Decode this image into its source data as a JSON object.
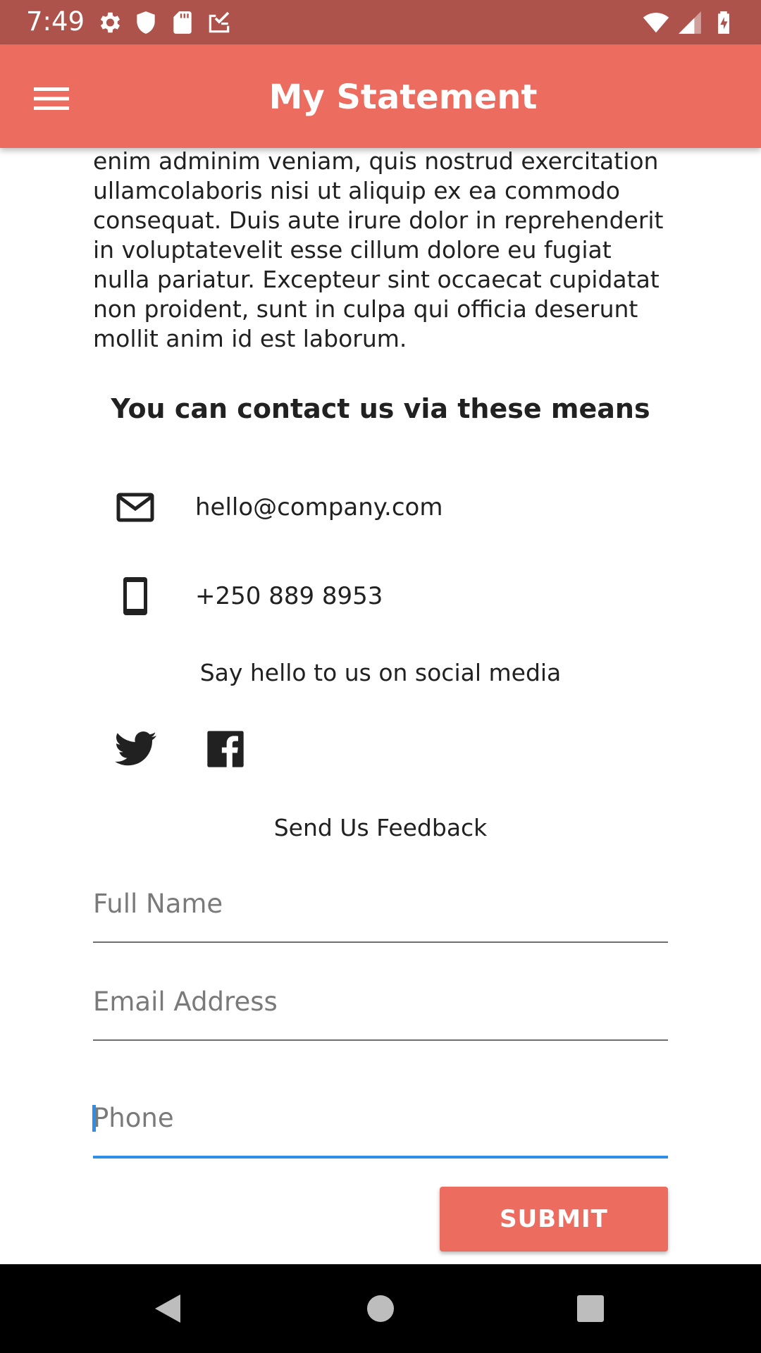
{
  "status_bar": {
    "time": "7:49",
    "left_icons": [
      "settings-icon",
      "shield-icon",
      "sd-card-icon",
      "check-list-icon"
    ],
    "right_icons": [
      "wifi-icon",
      "signal-icon",
      "battery-charging-icon"
    ],
    "background_color": "#ae534b"
  },
  "app_bar": {
    "title": "My Statement",
    "menu_icon": "hamburger-menu-icon",
    "background_color": "#ec6c60"
  },
  "content": {
    "paragraph": "enim adminim veniam, quis nostrud exercitation ullamcolaboris nisi ut aliquip ex ea commodo consequat. Duis aute irure dolor in reprehenderit in voluptatevelit esse cillum dolore eu fugiat nulla pariatur. Excepteur sint occaecat cupidatat non proident, sunt in culpa qui officia deserunt mollit anim id est laborum.",
    "contact_heading": "You can contact us via these means",
    "contacts": [
      {
        "icon": "mail-icon",
        "value": "hello@company.com"
      },
      {
        "icon": "phone-icon",
        "value": "+250 889 8953"
      }
    ],
    "social_caption": "Say hello to us on social media",
    "social_icons": [
      "twitter-icon",
      "facebook-icon"
    ],
    "feedback_title": "Send Us Feedback"
  },
  "form": {
    "full_name": {
      "placeholder": "Full Name",
      "value": ""
    },
    "email": {
      "placeholder": "Email Address",
      "value": ""
    },
    "phone": {
      "placeholder": "Phone",
      "value": "",
      "focused": true
    },
    "submit_label": "SUBMIT",
    "focus_color": "#2f8fe6"
  },
  "nav_bar": {
    "buttons": [
      "back-icon",
      "home-icon",
      "recents-icon"
    ]
  }
}
